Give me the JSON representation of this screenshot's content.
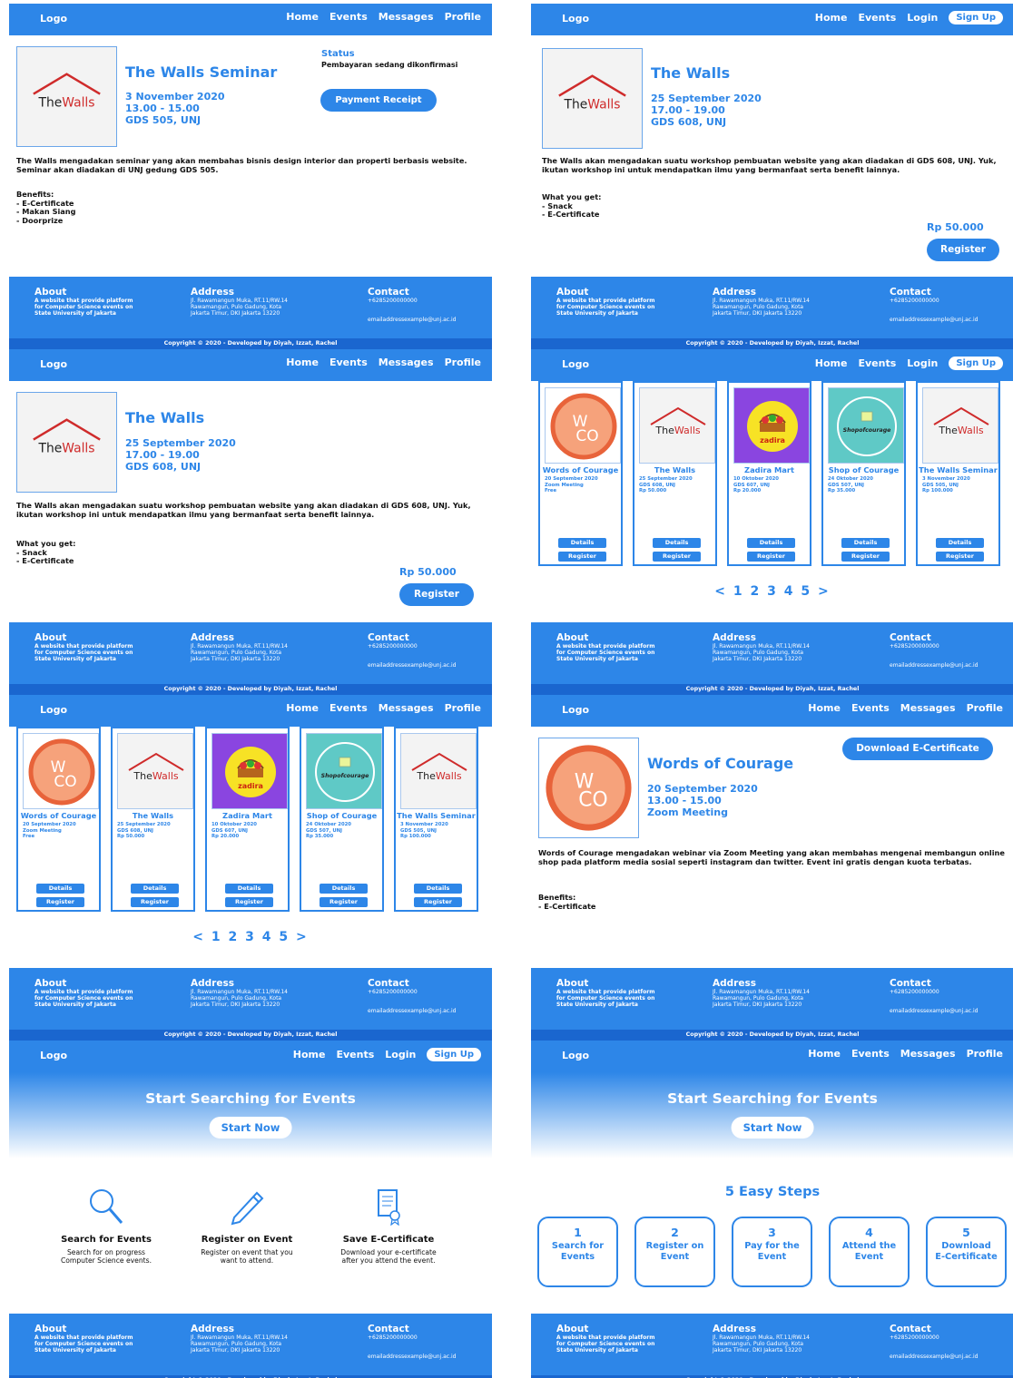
{
  "colors": {
    "primary": "#2d86e8",
    "dark_primary": "#1a66cf",
    "wall_red": "#cf2b2b"
  },
  "nav": {
    "logo": "Logo",
    "member_links": [
      "Home",
      "Events",
      "Messages",
      "Profile"
    ],
    "guest_links": [
      "Home",
      "Events",
      "Login"
    ],
    "signup": "Sign Up"
  },
  "footer": {
    "about_title": "About",
    "about_text": "A website that provide platform\nfor Computer Science events on\nState University of Jakarta",
    "address_title": "Address",
    "address_text": "Jl. Rawamangun Muka, RT.11/RW.14\nRawamangun, Pulo Gadung, Kota\nJakarta Timur, DKI Jakarta 13220",
    "contact_title": "Contact",
    "contact_phone": "+6285200000000",
    "contact_email": "emailaddressexample@unj.ac.id",
    "copyright": "Copyright © 2020 - Developed by Diyah, Izzat, Rachel"
  },
  "seminar": {
    "title": "The Walls Seminar",
    "date": "3 November 2020",
    "time": "13.00 - 15.00",
    "place": "GDS 505, UNJ",
    "status_label": "Status",
    "status_value": "Pembayaran sedang dikonfirmasi",
    "receipt_button": "Payment Receipt",
    "description": "The Walls mengadakan seminar yang akan membahas bisnis design interior dan properti berbasis website. Seminar akan diadakan di UNJ gedung GDS 505.",
    "benefits": "Benefits:\n- E-Certificate\n- Makan Siang\n- Doorprize"
  },
  "walls": {
    "title": "The Walls",
    "date": "25 September 2020",
    "time": "17.00 - 19.00",
    "place": "GDS 608, UNJ",
    "description": "The Walls akan mengadakan suatu workshop pembuatan website yang akan diadakan di GDS 608, UNJ. Yuk, ikutan workshop ini untuk mendapatkan ilmu yang bermanfaat serta benefit lainnya.",
    "what_you_get": "What you get:\n- Snack\n- E-Certificate",
    "price": "Rp 50.000",
    "register_button": "Register"
  },
  "logo_text": {
    "walls_a": "The",
    "walls_b": "Walls",
    "zadira": "zadira",
    "shop": "Shopofcourage"
  },
  "events": [
    {
      "title": "Words of Courage",
      "info": "20 September 2020\nZoom Meeting\nFree"
    },
    {
      "title": "The Walls",
      "info": "25 September 2020\nGDS 608, UNJ\nRp 50.000"
    },
    {
      "title": "Zadira Mart",
      "info": "10 Oktober 2020\nGDS 607, UNJ\nRp 20.000"
    },
    {
      "title": "Shop of Courage",
      "info": "24 Oktober 2020\nGDS 507, UNJ\nRp 35.000"
    },
    {
      "title": "The Walls Seminar",
      "info": "3 November 2020\nGDS 505, UNJ\nRp 100.000"
    }
  ],
  "card_buttons": {
    "details": "Details",
    "register": "Register"
  },
  "pager": "< 1 2 3 4 5 >",
  "courage": {
    "title": "Words of Courage",
    "date": "20 September 2020",
    "time": "13.00 - 15.00",
    "place": "Zoom Meeting",
    "download_button": "Download E-Certificate",
    "description": "Words of Courage mengadakan webinar via Zoom Meeting yang akan membahas mengenai membangun online shop pada platform media sosial seperti instagram dan twitter. Event ini gratis dengan kuota terbatas.",
    "benefits": "Benefits:\n- E-Certificate"
  },
  "home": {
    "hero_title": "Start Searching for Events",
    "start_button": "Start Now",
    "features": [
      {
        "title": "Search for Events",
        "desc": "Search for on progress\nComputer Science events."
      },
      {
        "title": "Register on Event",
        "desc": "Register on event that you\nwant to attend."
      },
      {
        "title": "Save E-Certificate",
        "desc": "Download your e-certificate\nafter you attend the event."
      }
    ],
    "steps_title": "5 Easy Steps",
    "steps": [
      {
        "num": "1",
        "label": "Search for\nEvents"
      },
      {
        "num": "2",
        "label": "Register on\nEvent"
      },
      {
        "num": "3",
        "label": "Pay for the\nEvent"
      },
      {
        "num": "4",
        "label": "Attend the\nEvent"
      },
      {
        "num": "5",
        "label": "Download\nE-Certificate"
      }
    ]
  }
}
